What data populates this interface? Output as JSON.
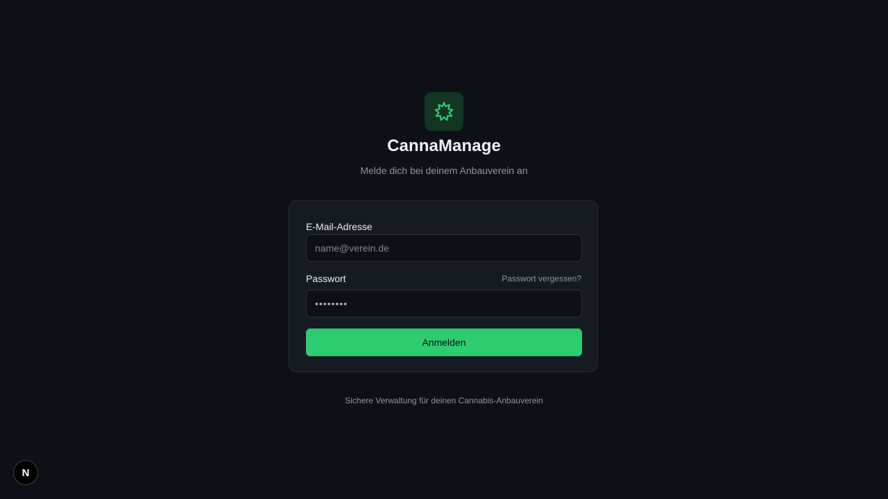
{
  "brand": {
    "logo_icon": "cannabis-leaf-icon",
    "title": "CannaManage",
    "subtitle": "Melde dich bei deinem Anbauverein an"
  },
  "form": {
    "email_label": "E-Mail-Adresse",
    "email_placeholder": "name@verein.de",
    "email_value": "",
    "password_label": "Passwort",
    "forgot_label": "Passwort vergessen?",
    "password_value": "••••••••",
    "submit_label": "Anmelden"
  },
  "footer": {
    "note": "Sichere Verwaltung für deinen Cannabis-Anbauverein"
  },
  "dev_badge": {
    "icon": "nextjs-icon",
    "letter": "N"
  },
  "colors": {
    "background": "#0d1117",
    "card": "#161b22",
    "accent": "#2ecc71"
  }
}
